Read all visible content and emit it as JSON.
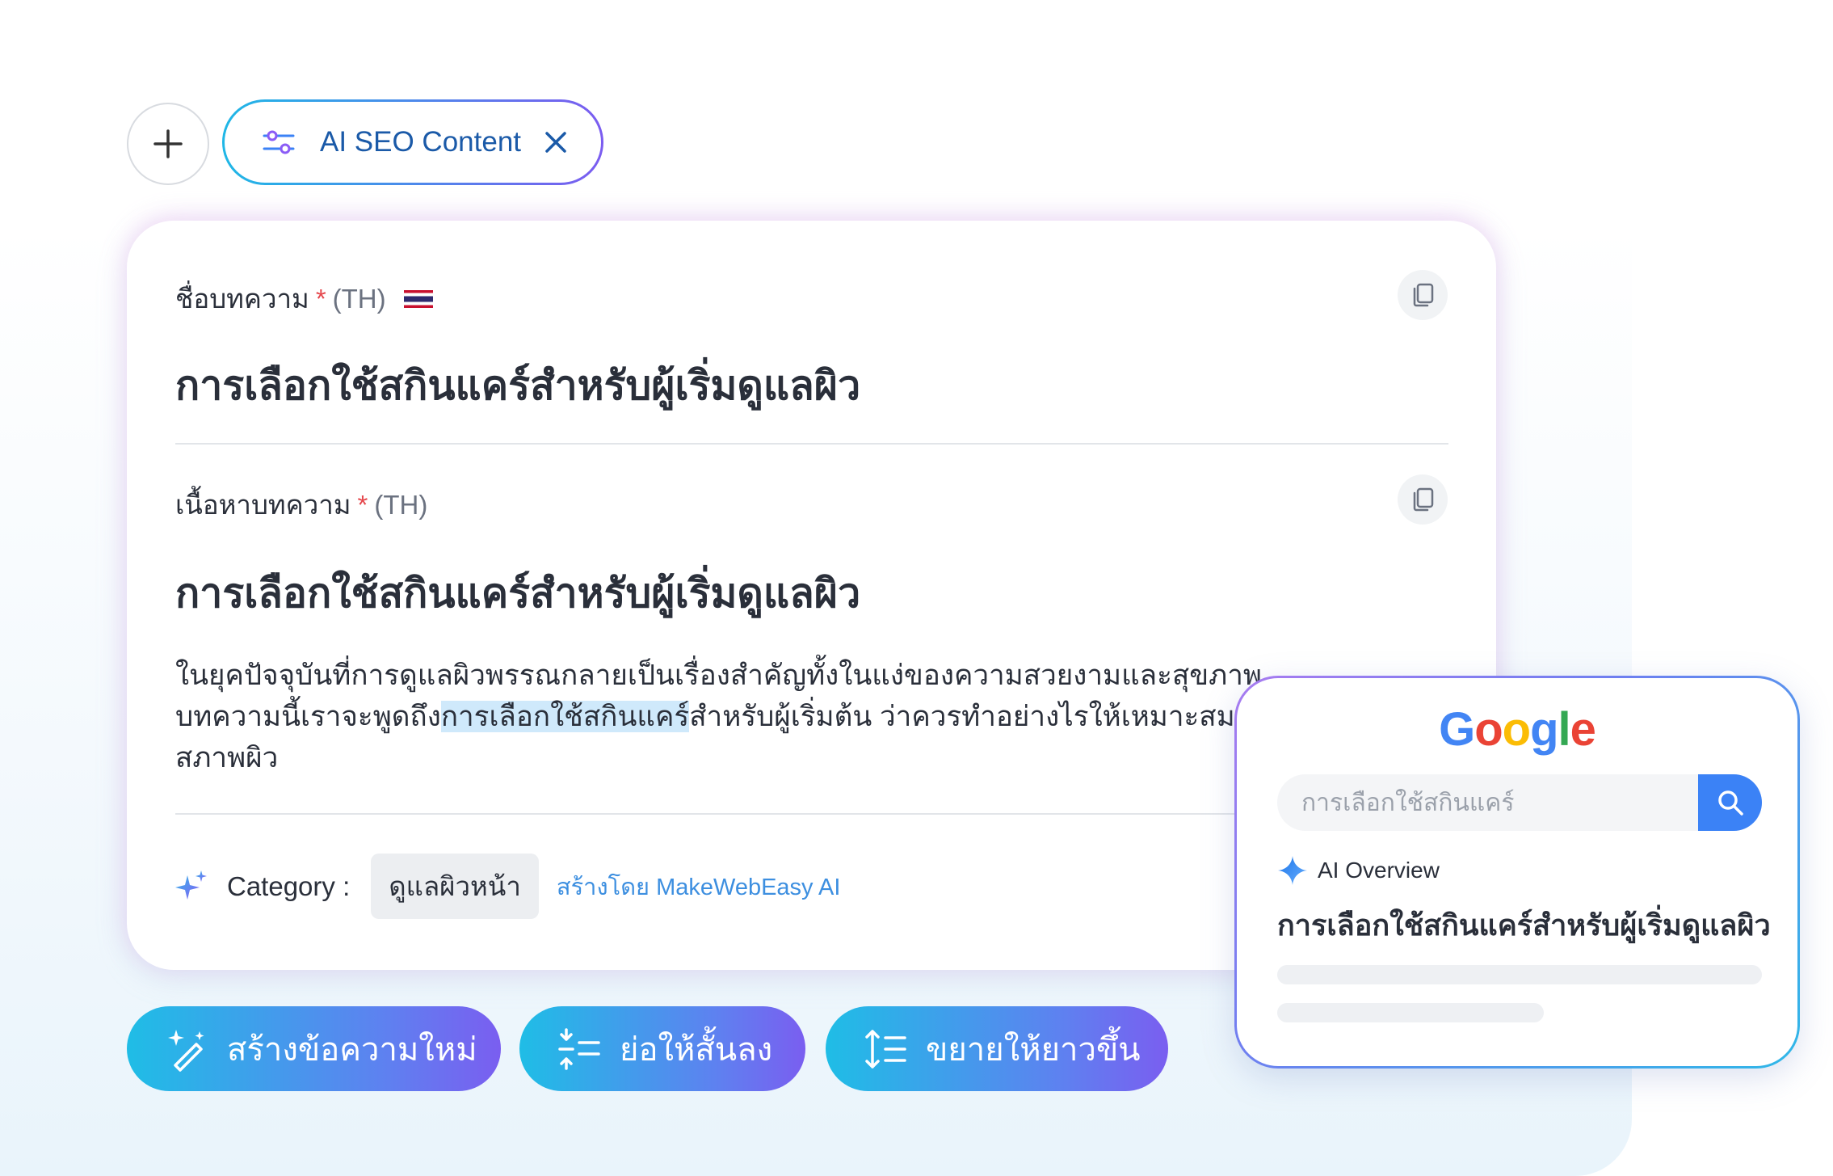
{
  "toolbar": {
    "add_icon": "plus-icon",
    "chip": {
      "label": "AI SEO Content",
      "icon": "sliders-icon",
      "close_icon": "close-icon"
    }
  },
  "article": {
    "title_field": {
      "label": "ชื่อบทความ",
      "required_mark": "*",
      "lang": "(TH)",
      "flag_icon": "thai-flag-icon",
      "value": "การเลือกใช้สกินแคร์สำหรับผู้เริ่มดูแลผิว"
    },
    "content_field": {
      "label": "เนื้อหาบทความ",
      "required_mark": "*",
      "lang": "(TH)",
      "heading": "การเลือกใช้สกินแคร์สำหรับผู้เริ่มดูแลผิว",
      "paragraph_before": "ในยุคปัจจุบันที่การดูแลผิวพรรณกลายเป็นเรื่องสำคัญทั้งในแง่ของความสวยงามและสุขภาพ บทความนี้เราจะพูดถึง",
      "paragraph_highlight": "การเลือกใช้สกินแคร์",
      "paragraph_after": "สำหรับผู้เริ่มต้น ว่าควรทำอย่างไรให้เหมาะสมกับสภาพผิว"
    },
    "category": {
      "icon": "sparkle-icon",
      "label": "Category :",
      "value": "ดูแลผิวหน้า",
      "generated_by": "สร้างโดย MakeWebEasy AI"
    }
  },
  "actions": [
    {
      "label": "สร้างข้อความใหม่",
      "icon": "magic-wand-icon"
    },
    {
      "label": "ย่อให้สั้นลง",
      "icon": "shorten-icon"
    },
    {
      "label": "ขยายให้ยาวขึ้น",
      "icon": "expand-icon"
    }
  ],
  "google_preview": {
    "logo_letters": [
      "G",
      "o",
      "o",
      "g",
      "l",
      "e"
    ],
    "logo_colors": [
      "#4285F4",
      "#EA4335",
      "#FBBC05",
      "#4285F4",
      "#34A853",
      "#EA4335"
    ],
    "search_query": "การเลือกใช้สกินแคร์",
    "ai_overview_label": "AI Overview",
    "result_title": "การเลือกใช้สกินแคร์สำหรับผู้เริ่มดูแลผิว"
  },
  "colors": {
    "accent_blue": "#1b5aa8",
    "gradient_start": "#1fbde6",
    "gradient_end": "#7a5ef0",
    "highlight": "#cfe9fb",
    "required": "#e5484d"
  }
}
